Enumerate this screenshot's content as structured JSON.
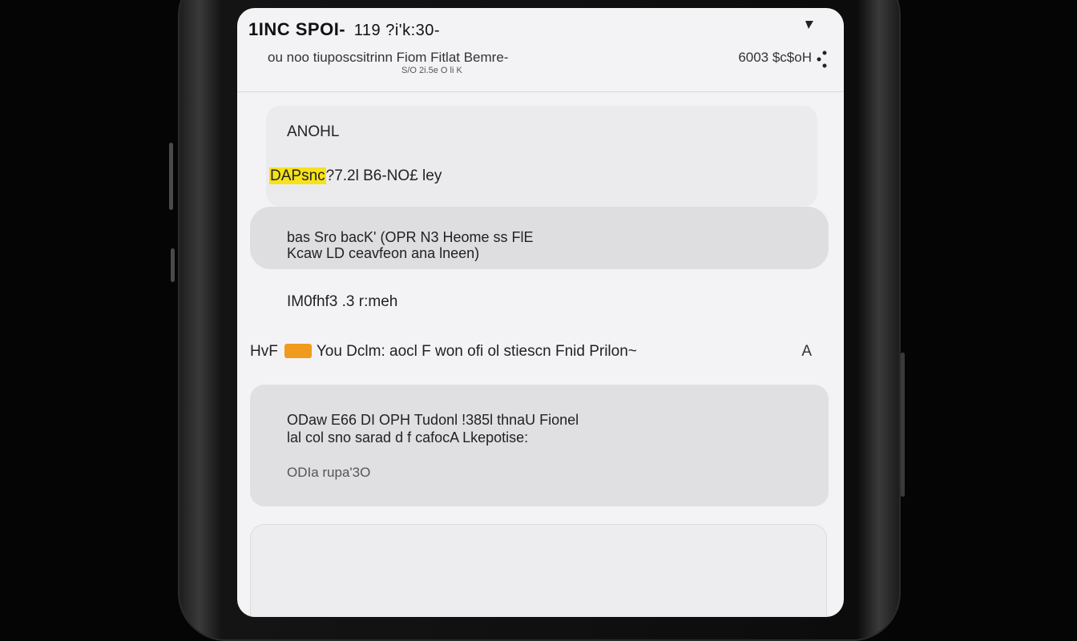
{
  "status_bar": {
    "carrier": "1INC SPOI-",
    "time": "119 ?i'k:30-"
  },
  "header": {
    "subtitle": "ou noo tiuposcsitrinn Fiom Fitlat Bemre-",
    "subtitle_small": "S/O 2i.5e O li K",
    "right_status": "6003 $c$oH"
  },
  "card1": {
    "title": "ANOHL",
    "highlight": "DAPsnc",
    "line": "?7.2l B6-NO£ ley"
  },
  "card2": {
    "line1": "bas Sro      bacK' (OPR N3 Heome ss FlE",
    "line2": "Kcaw LD ceavfeon ana lneen)"
  },
  "row": {
    "label": "IM0fhf3 .3 r:meh"
  },
  "notification": {
    "prefix": "HvF",
    "text": "You Dclm: aocl F won ofi ol stiescn Fnid Prilon~",
    "end": "A"
  },
  "card3": {
    "line1": "ODaw E66 DI OPH Tudonl !385l thnaU Fionel",
    "line2": "lal col sno sarad d   f cafocA Lkepotise:",
    "line3": "ODIa rupa'3O"
  },
  "colors": {
    "highlight": "#f7e11a",
    "tag": "#f09a1e",
    "screen_bg": "#f3f3f5"
  }
}
